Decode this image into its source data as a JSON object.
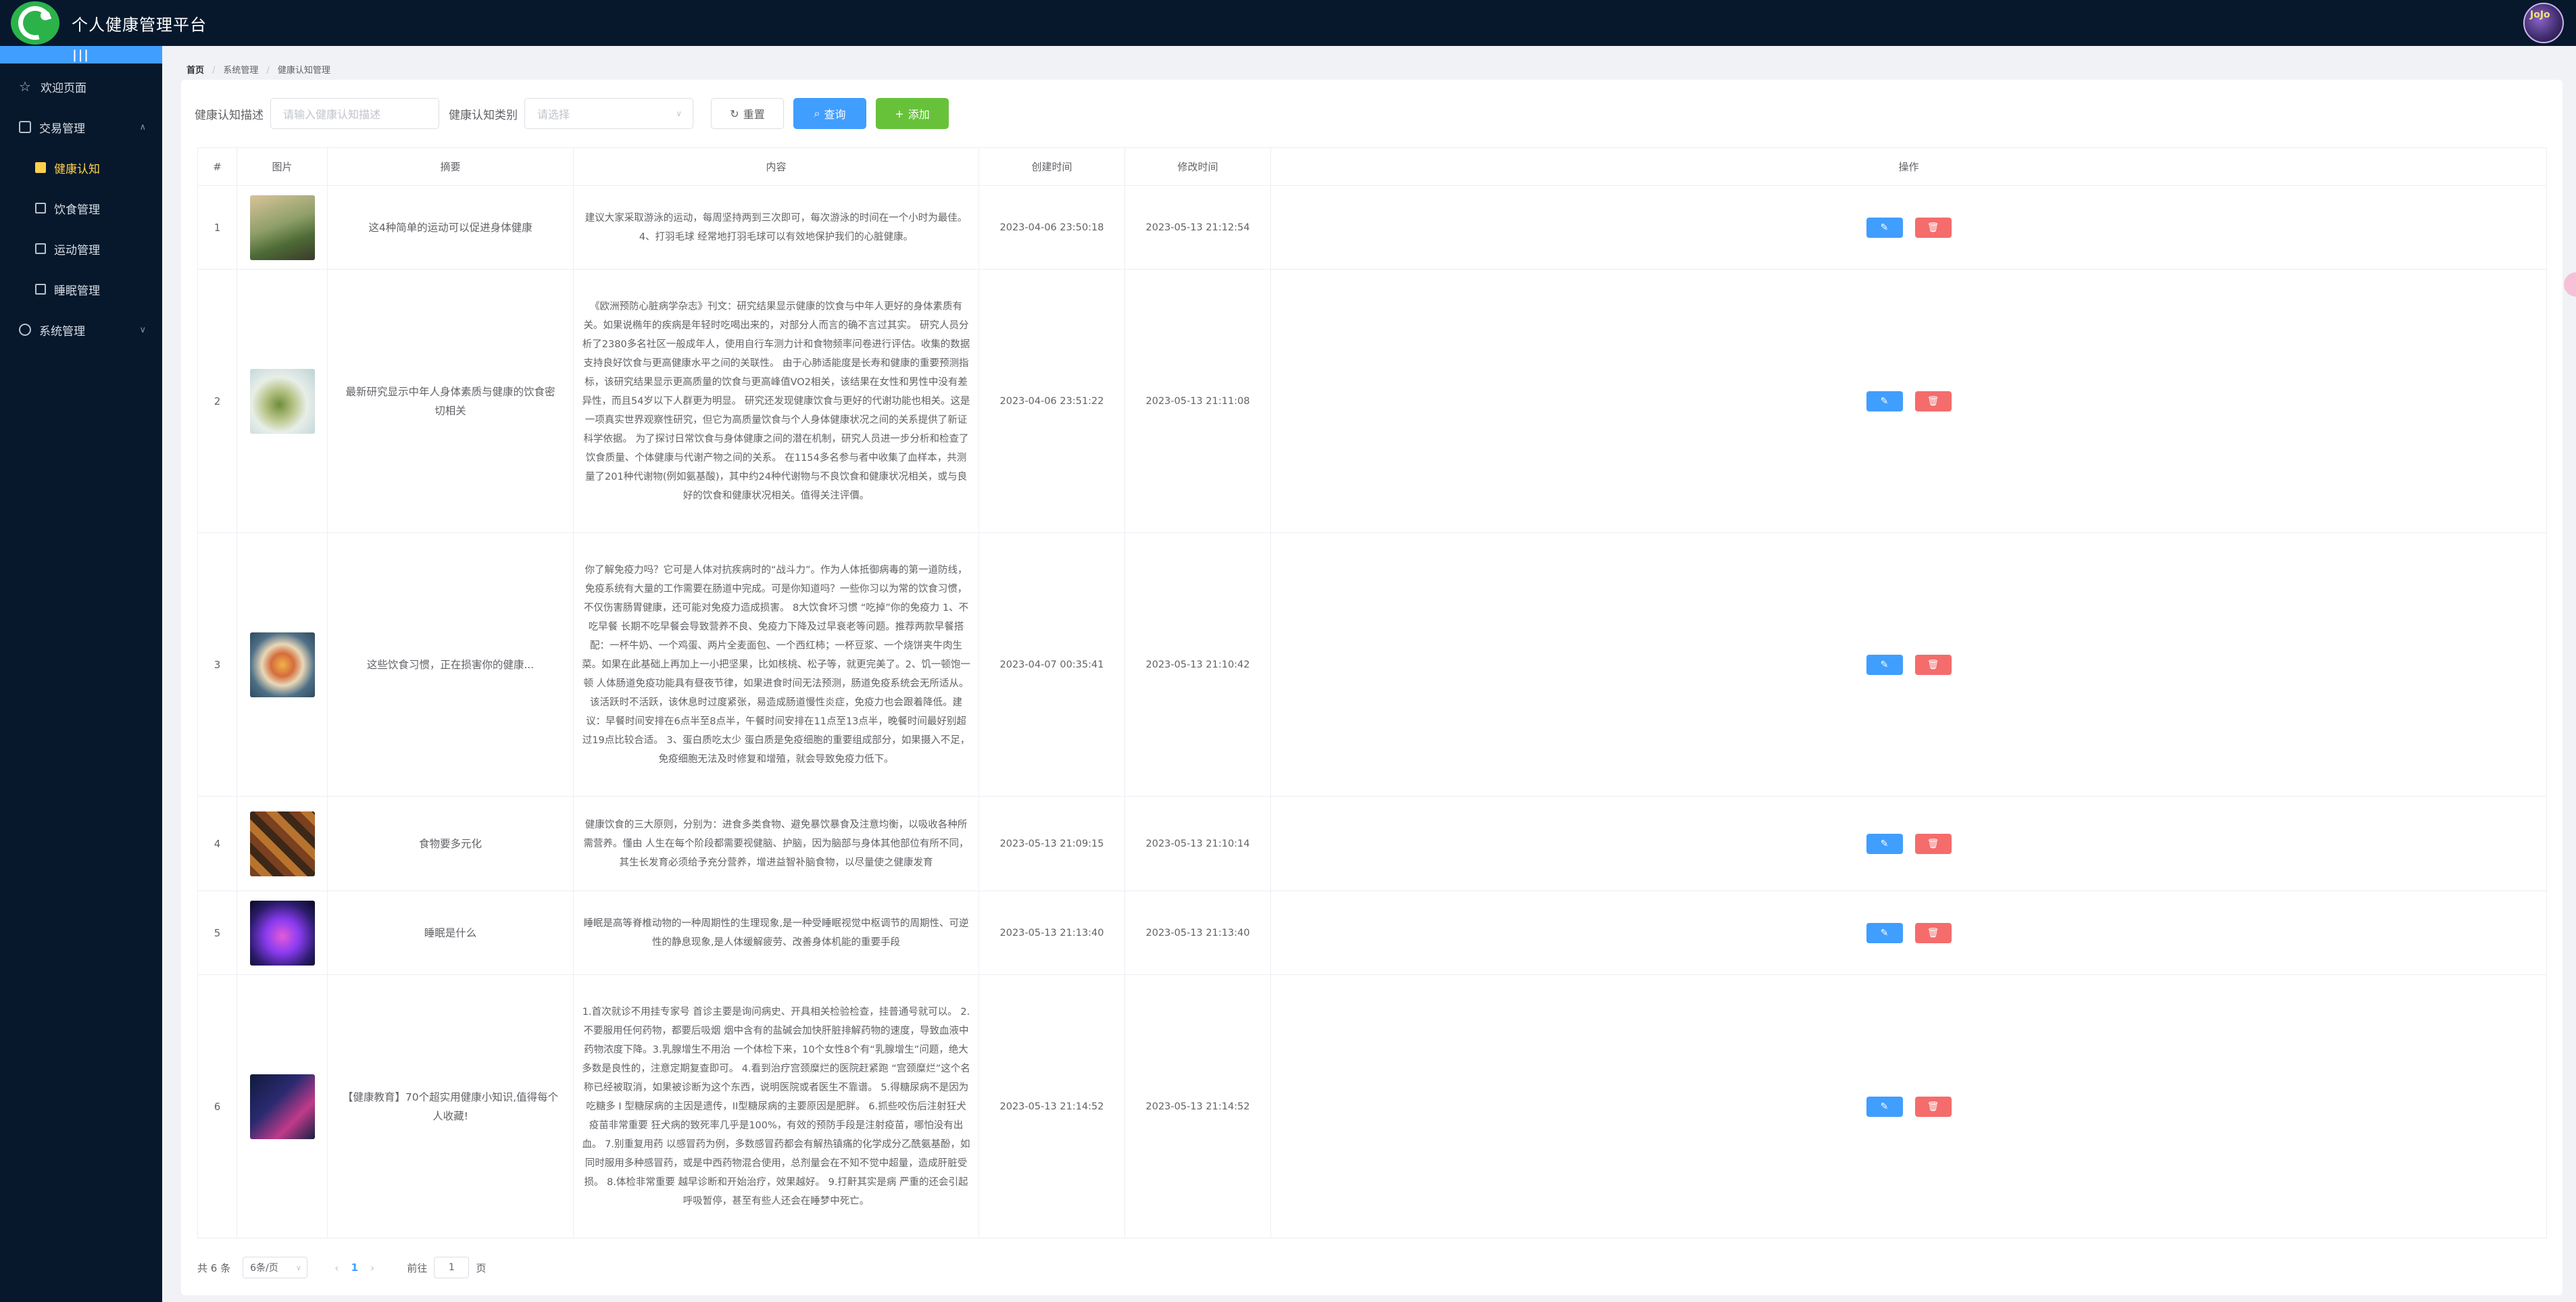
{
  "app": {
    "title": "个人健康管理平台",
    "avatar_text": "JoJo"
  },
  "sidebar": {
    "collapse": "|||",
    "items": [
      {
        "label": "欢迎页面",
        "icon": "star-icon"
      },
      {
        "label": "交易管理",
        "icon": "shop-icon"
      },
      {
        "label": "系统管理",
        "icon": "gear-icon"
      }
    ],
    "sub_items": [
      {
        "label": "健康认知",
        "icon": "home-icon",
        "active": true
      },
      {
        "label": "饮食管理",
        "icon": "flag-icon"
      },
      {
        "label": "运动管理",
        "icon": "monitor-icon"
      },
      {
        "label": "睡眠管理",
        "icon": "picture-icon"
      }
    ]
  },
  "breadcrumb": {
    "home": "首页",
    "level1": "系统管理",
    "level2": "健康认知管理"
  },
  "filters": {
    "desc_label": "健康认知描述",
    "desc_placeholder": "请输入健康认知描述",
    "type_label": "健康认知类别",
    "type_placeholder": "请选择",
    "reset": "重置",
    "search": "查询",
    "add": "添加"
  },
  "table": {
    "headers": [
      "#",
      "图片",
      "摘要",
      "内容",
      "创建时间",
      "修改时间",
      "操作"
    ],
    "rows": [
      {
        "index": "1",
        "summary": "这4种简单的运动可以促进身体健康",
        "content": "建议大家采取游泳的运动，每周坚持两到三次即可，每次游泳的时间在一个小时为最佳。4、打羽毛球 经常地打羽毛球可以有效地保护我们的心脏健康。",
        "created": "2023-04-06 23:50:18",
        "modified": "2023-05-13 21:12:54"
      },
      {
        "index": "2",
        "summary": "最新研究显示中年人身体素质与健康的饮食密切相关",
        "content": "《欧洲预防心脏病学杂志》刊文：研究结果显示健康的饮食与中年人更好的身体素质有关。如果说椭年的疾病是年轻时吃喝出来的，对部分人而言的确不言过其实。 研究人员分析了2380多名社区一般成年人，使用自行车测力计和食物频率问卷进行评估。收集的数据支持良好饮食与更高健康水平之间的关联性。 由于心肺适能度是长寿和健康的重要预测指标，该研究结果显示更高质量的饮食与更高峰值VO2相关，该结果在女性和男性中没有差异性，而且54岁以下人群更为明显。 研究还发现健康饮食与更好的代谢功能也相关。这是一项真实世界观察性研究，但它为高质量饮食与个人身体健康状况之间的关系提供了新证科学依据。 为了探讨日常饮食与身体健康之间的潜在机制，研究人员进一步分析和检查了饮食质量、个体健康与代谢产物之间的关系。 在1154多名参与者中收集了血样本，共测量了201种代谢物(例如氨基酸)，其中约24种代谢物与不良饮食和健康状况相关，或与良好的饮食和健康状况相关。值得关注评價。",
        "created": "2023-04-06 23:51:22",
        "modified": "2023-05-13 21:11:08"
      },
      {
        "index": "3",
        "summary": "这些饮食习惯，正在损害你的健康...",
        "content": "你了解免疫力吗？它可是人体对抗疾病时的“战斗力”。作为人体抵御病毒的第一道防线，免疫系统有大量的工作需要在肠道中完成。可是你知道吗？一些你习以为常的饮食习惯，不仅伤害肠胃健康，还可能对免疫力造成损害。 8大饮食坏习惯 “吃掉”你的免疫力 1、不吃早餐 长期不吃早餐会导致营养不良、免疫力下降及过早衰老等问题。推荐两款早餐搭配：一杯牛奶、一个鸡蛋、两片全麦面包、一个西红柿；一杯豆浆、一个烧饼夹牛肉生菜。如果在此基础上再加上一小把坚果，比如核桃、松子等，就更完美了。2、饥一顿饱一顿 人体肠道免疫功能具有昼夜节律，如果进食时间无法预测，肠道免疫系统会无所适从。该活跃时不活跃，该休息时过度紧张，易造成肠道慢性炎症，免疫力也会跟着降低。建议：早餐时间安排在6点半至8点半，午餐时间安排在11点至13点半，晚餐时间最好别超过19点比较合适。 3、蛋白质吃太少 蛋白质是免疫细胞的重要组成部分，如果摄入不足，免疫细胞无法及时修复和增殖，就会导致免疫力低下。",
        "created": "2023-04-07 00:35:41",
        "modified": "2023-05-13 21:10:42"
      },
      {
        "index": "4",
        "summary": "食物要多元化",
        "content": "健康饮食的三大原则，分别为：进食多类食物、避免暴饮暴食及注意均衡，以吸收各种所需营养。懂由 人生在每个阶段都需要视健脑、护脑，因为脑部与身体其他部位有所不同，其生长发育必须给予充分营养，增进益智补脑食物，以尽量使之健康发育",
        "created": "2023-05-13 21:09:15",
        "modified": "2023-05-13 21:10:14"
      },
      {
        "index": "5",
        "summary": "睡眠是什么",
        "content": "睡眠是高等脊椎动物的一种周期性的生理现象,是一种受睡眠视觉中枢调节的周期性、可逆性的静息现象,是人体缓解疲劳、改善身体机能的重要手段",
        "created": "2023-05-13 21:13:40",
        "modified": "2023-05-13 21:13:40"
      },
      {
        "index": "6",
        "summary": "【健康教育】70个超实用健康小知识,值得每个人收藏!",
        "content": "1.首次就诊不用挂专家号 首诊主要是询问病史、开具相关检验检查，挂普通号就可以。 2.不要服用任何药物，都要后吸烟 烟中含有的盐碱会加快肝脏排解药物的速度，导致血液中药物浓度下降。3.乳腺增生不用治 一个体检下来，10个女性8个有“乳腺增生”问题，绝大多数是良性的，注意定期复查即可。 4.看到治疗宫颈糜烂的医院赶紧跑 “宫颈糜烂”这个名称已经被取消，如果被诊断为这个东西，说明医院或者医生不靠谱。 5.得糖尿病不是因为吃糖多 I 型糖尿病的主因是遗传，II型糖尿病的主要原因是肥胖。 6.抓些咬伤后注射狂犬疫苗非常重要 狂犬病的致死率几乎是100%，有效的预防手段是注射疫苗，哪怕没有出血。 7.别重复用药 以感冒药为例，多数感冒药都会有解热镇痛的化学成分乙酰氨基酚，如同时服用多种感冒药，或是中西药物混合使用，总剂量会在不知不觉中超量，造成肝脏受损。 8.体检非常重要 越早诊断和开始治疗，效果越好。 9.打鼾其实是病 严重的还会引起呼吸暂停，甚至有些人还会在睡梦中死亡。",
        "created": "2023-05-13 21:14:52",
        "modified": "2023-05-13 21:14:52"
      }
    ]
  },
  "pagination": {
    "total": "共 6 条",
    "page_size": "6条/页",
    "prev": "‹",
    "current": "1",
    "next": "›",
    "goto_label": "前往",
    "goto_value": "1",
    "goto_suffix": "页"
  }
}
